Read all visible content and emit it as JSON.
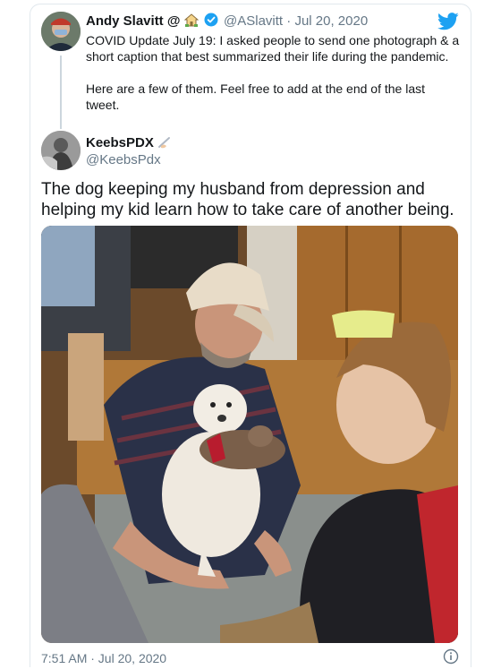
{
  "quoted_tweet": {
    "display_name": "Andy Slavitt @",
    "handle": "@ASlavitt",
    "separator": "·",
    "date": "Jul 20, 2020",
    "paragraph_1": "COVID Update July 19: I asked people to send one photograph & a short caption that best summarized their life during the pandemic.",
    "paragraph_2": "Here are a few of them. Feel free to add at the end of the last tweet."
  },
  "reply_tweet": {
    "display_name": "KeebsPDX",
    "handle": "@KeebsPdx",
    "text": "The dog keeping my husband from depression and helping my kid learn how to take care of another being.",
    "timestamp": "7:51 AM · Jul 20, 2020"
  },
  "colors": {
    "twitter_blue": "#1da1f2",
    "muted_text": "#657786",
    "border": "#e1e8ed"
  },
  "icons": [
    "twitter-bird-icon",
    "verified-badge-icon",
    "house-emoji-icon",
    "writing-hand-emoji-icon",
    "info-icon"
  ]
}
